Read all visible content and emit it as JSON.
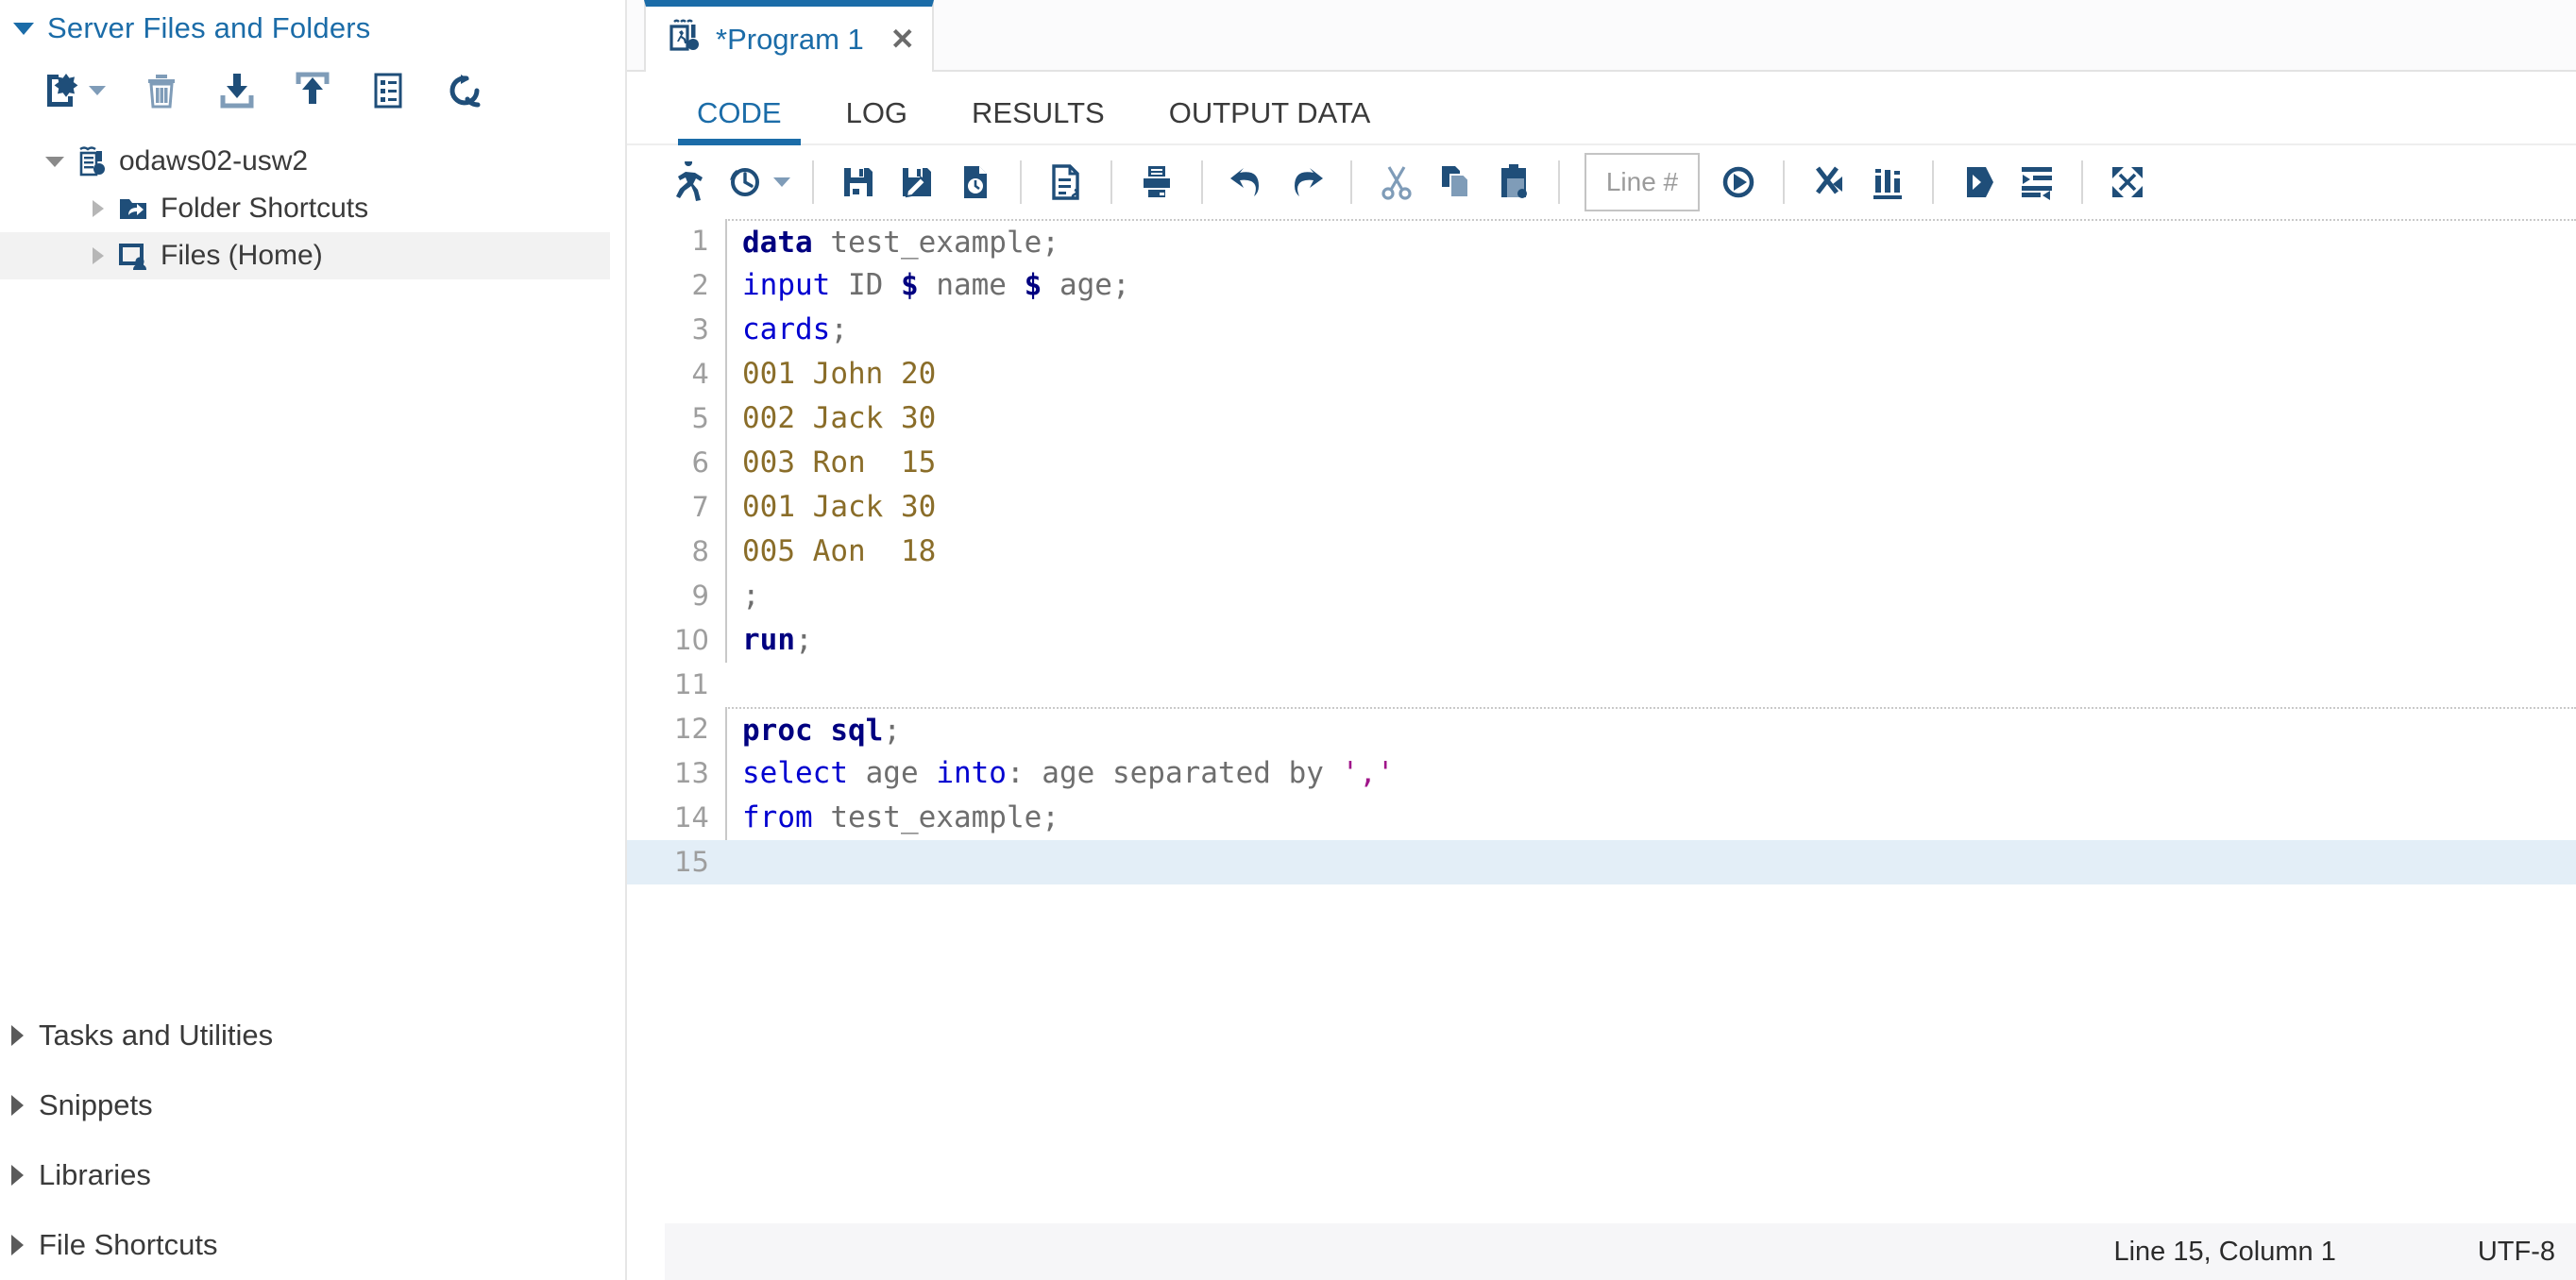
{
  "sidebar": {
    "section_title": "Server Files and Folders",
    "toolbar": [
      {
        "name": "new-icon",
        "title": "New"
      },
      {
        "name": "delete-icon",
        "title": "Delete"
      },
      {
        "name": "download-icon",
        "title": "Download"
      },
      {
        "name": "upload-icon",
        "title": "Upload"
      },
      {
        "name": "properties-icon",
        "title": "Properties"
      },
      {
        "name": "refresh-icon",
        "title": "Refresh"
      }
    ],
    "tree": [
      {
        "label": "odaws02-usw2",
        "icon": "server-icon",
        "level": 1,
        "expanded": true,
        "selected": false
      },
      {
        "label": "Folder Shortcuts",
        "icon": "folder-shortcut-icon",
        "level": 2,
        "expanded": false,
        "selected": false
      },
      {
        "label": "Files (Home)",
        "icon": "home-files-icon",
        "level": 2,
        "expanded": false,
        "selected": true
      }
    ],
    "bottom_sections": [
      {
        "label": "Tasks and Utilities"
      },
      {
        "label": "Snippets"
      },
      {
        "label": "Libraries"
      },
      {
        "label": "File Shortcuts"
      }
    ]
  },
  "tabstrip": {
    "tab_label": "*Program 1",
    "tab_icon": "sas-program-icon",
    "close_label": "✕"
  },
  "subtabs": [
    {
      "label": "CODE",
      "active": true
    },
    {
      "label": "LOG",
      "active": false
    },
    {
      "label": "RESULTS",
      "active": false
    },
    {
      "label": "OUTPUT DATA",
      "active": false
    }
  ],
  "code_toolbar": {
    "line_number_placeholder": "Line #",
    "items": [
      {
        "name": "run-icon",
        "title": "Run"
      },
      {
        "name": "run-history-icon",
        "title": "Run history",
        "caret": true
      },
      {
        "sep": true
      },
      {
        "name": "save-icon",
        "title": "Save"
      },
      {
        "name": "save-as-icon",
        "title": "Save As"
      },
      {
        "name": "save-snapshot-icon",
        "title": "Save snapshot"
      },
      {
        "sep": true
      },
      {
        "name": "format-code-icon",
        "title": "Format code"
      },
      {
        "sep": true
      },
      {
        "name": "print-icon",
        "title": "Print"
      },
      {
        "sep": true
      },
      {
        "name": "undo-icon",
        "title": "Undo"
      },
      {
        "name": "redo-icon",
        "title": "Redo"
      },
      {
        "sep": true
      },
      {
        "name": "cut-icon",
        "title": "Cut"
      },
      {
        "name": "copy-icon",
        "title": "Copy"
      },
      {
        "name": "paste-icon",
        "title": "Paste"
      },
      {
        "sep": true
      },
      {
        "name": "line-number-input",
        "title": "Line #"
      },
      {
        "name": "goto-line-icon",
        "title": "Go to line"
      },
      {
        "sep": true
      },
      {
        "name": "clear-all-icon",
        "title": "Clear all"
      },
      {
        "name": "analyze-program-icon",
        "title": "Analyze program"
      },
      {
        "sep": true
      },
      {
        "name": "indent-more-icon",
        "title": "Add indent"
      },
      {
        "name": "indent-less-icon",
        "title": "Remove indent"
      },
      {
        "sep": true
      },
      {
        "name": "maximize-icon",
        "title": "Maximize view"
      }
    ]
  },
  "editor": {
    "current_line": 15,
    "lines": [
      {
        "n": 1,
        "stepsep": true,
        "tokens": [
          {
            "t": "data",
            "c": "kb"
          },
          {
            "t": " test_example;",
            "c": "pl"
          }
        ]
      },
      {
        "n": 2,
        "stepsep": false,
        "tokens": [
          {
            "t": "input",
            "c": "k"
          },
          {
            "t": " ID ",
            "c": "pl"
          },
          {
            "t": "$",
            "c": "kb"
          },
          {
            "t": " name ",
            "c": "pl"
          },
          {
            "t": "$",
            "c": "kb"
          },
          {
            "t": " age;",
            "c": "pl"
          }
        ]
      },
      {
        "n": 3,
        "stepsep": false,
        "tokens": [
          {
            "t": "cards",
            "c": "k"
          },
          {
            "t": ";",
            "c": "pl"
          }
        ]
      },
      {
        "n": 4,
        "stepsep": false,
        "tokens": [
          {
            "t": "001 John 20",
            "c": "dt"
          }
        ]
      },
      {
        "n": 5,
        "stepsep": false,
        "tokens": [
          {
            "t": "002 Jack 30",
            "c": "dt"
          }
        ]
      },
      {
        "n": 6,
        "stepsep": false,
        "tokens": [
          {
            "t": "003 Ron  15",
            "c": "dt"
          }
        ]
      },
      {
        "n": 7,
        "stepsep": false,
        "tokens": [
          {
            "t": "001 Jack 30",
            "c": "dt"
          }
        ]
      },
      {
        "n": 8,
        "stepsep": false,
        "tokens": [
          {
            "t": "005 Aon  18",
            "c": "dt"
          }
        ]
      },
      {
        "n": 9,
        "stepsep": false,
        "tokens": [
          {
            "t": ";",
            "c": "pl"
          }
        ]
      },
      {
        "n": 10,
        "stepsep": false,
        "tokens": [
          {
            "t": "run",
            "c": "kb"
          },
          {
            "t": ";",
            "c": "pl"
          }
        ]
      },
      {
        "n": 11,
        "stepsep": false,
        "tokens": [
          {
            "t": "",
            "c": "pl"
          }
        ]
      },
      {
        "n": 12,
        "stepsep": true,
        "tokens": [
          {
            "t": "proc sql",
            "c": "kb"
          },
          {
            "t": ";",
            "c": "pl"
          }
        ]
      },
      {
        "n": 13,
        "stepsep": false,
        "tokens": [
          {
            "t": "select",
            "c": "k"
          },
          {
            "t": " age ",
            "c": "pl"
          },
          {
            "t": "into",
            "c": "k"
          },
          {
            "t": ": age separated by ",
            "c": "pl"
          },
          {
            "t": "','",
            "c": "st"
          }
        ]
      },
      {
        "n": 14,
        "stepsep": false,
        "tokens": [
          {
            "t": "from",
            "c": "k"
          },
          {
            "t": " test_example;",
            "c": "pl"
          }
        ]
      },
      {
        "n": 15,
        "stepsep": false,
        "tokens": [
          {
            "t": "",
            "c": "pl"
          }
        ]
      }
    ]
  },
  "statusbar": {
    "position": "Line 15, Column 1",
    "encoding": "UTF-8"
  },
  "colors": {
    "accent": "#1b6ca8",
    "icon_dark": "#1f4e79",
    "icon_light": "#7f9cb8",
    "keyword": "#0000d0",
    "keyword_bold": "#000080",
    "data_text": "#8a6d29",
    "string": "#a0158a",
    "plain": "#6e6e6e",
    "current_line_bg": "#e3eef7"
  }
}
